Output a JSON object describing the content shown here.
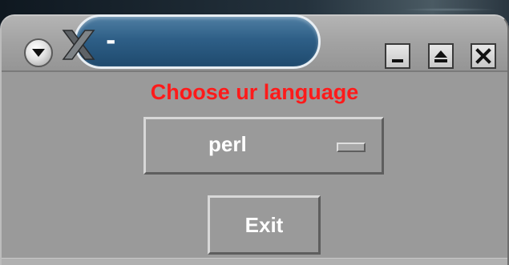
{
  "window": {
    "title": "-",
    "logo_icon": "x-logo-icon",
    "controls": [
      "menu-icon",
      "minimize-icon",
      "maximize-icon",
      "close-icon"
    ]
  },
  "form": {
    "heading": "Choose ur language",
    "language_select": {
      "selected": "perl"
    },
    "exit_label": "Exit"
  },
  "colors": {
    "heading": "#ff1a1a",
    "title_pill": "#2e5f87",
    "window_bg": "#9a9a9a"
  }
}
